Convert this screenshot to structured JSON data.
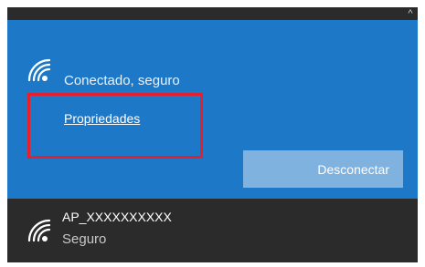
{
  "connected_card": {
    "status": "Conectado, seguro",
    "properties_link": "Propriedades",
    "disconnect_label": "Desconectar"
  },
  "networks": [
    {
      "name": "AP_XXXXXXXXXX",
      "security": "Seguro"
    }
  ],
  "icons": {
    "wifi": "wifi-icon",
    "scroll_up": "chevron-up-icon"
  },
  "colors": {
    "accent": "#1e78c8",
    "panel_bg": "#2b2b2b",
    "button_bg": "#7fb2df",
    "highlight": "#e5202e"
  }
}
